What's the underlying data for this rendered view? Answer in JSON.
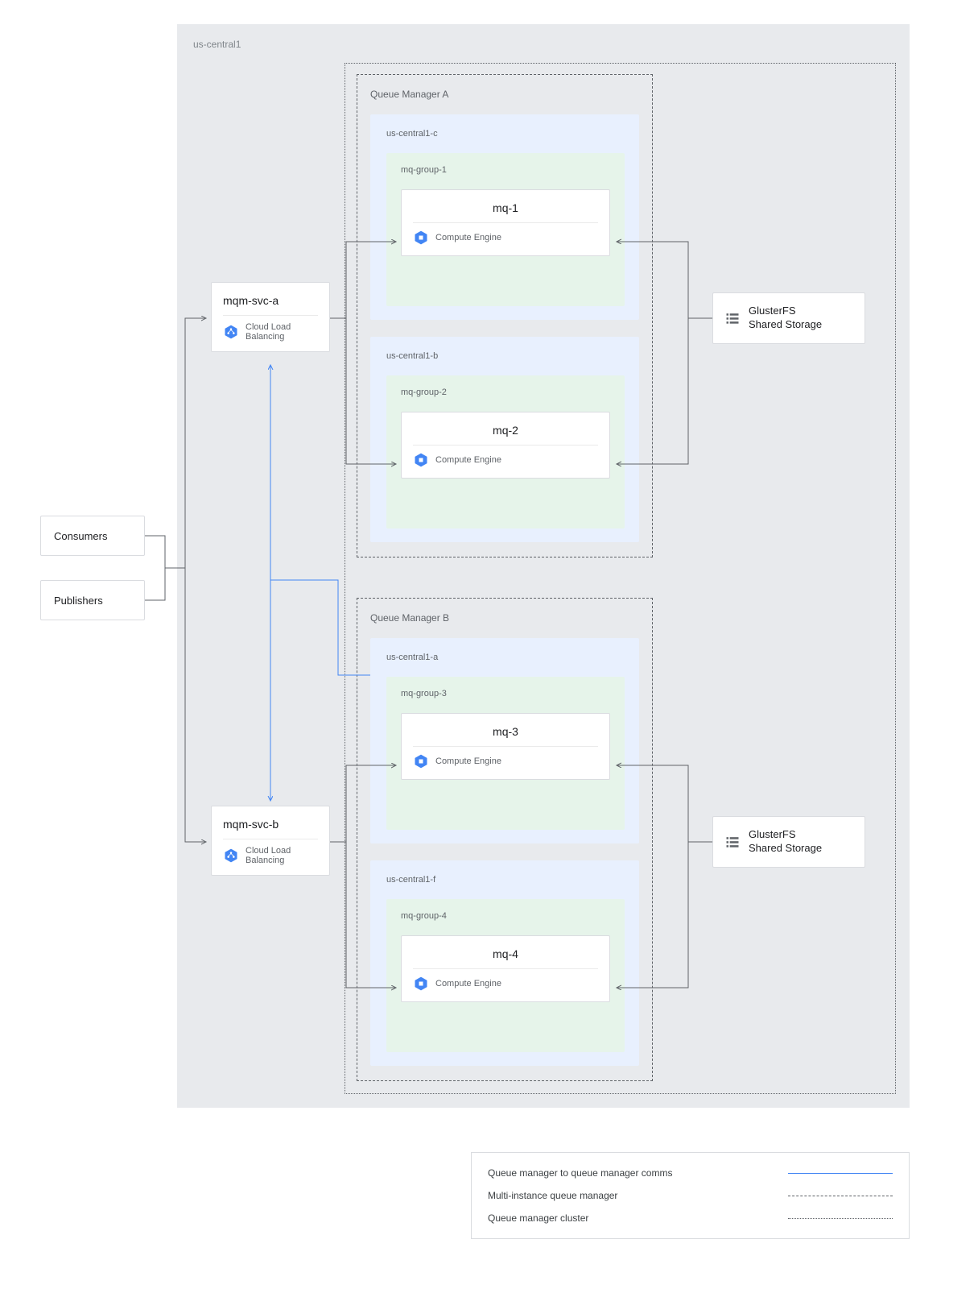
{
  "region": {
    "label": "us-central1"
  },
  "clients": {
    "consumers": "Consumers",
    "publishers": "Publishers"
  },
  "services": {
    "a": {
      "title": "mqm-svc-a",
      "sub": "Cloud Load Balancing"
    },
    "b": {
      "title": "mqm-svc-b",
      "sub": "Cloud Load Balancing"
    }
  },
  "queue_managers": {
    "a": {
      "label": "Queue Manager A",
      "zones": [
        {
          "zone": "us-central1-c",
          "group": "mq-group-1",
          "node": {
            "title": "mq-1",
            "sub": "Compute Engine"
          }
        },
        {
          "zone": "us-central1-b",
          "group": "mq-group-2",
          "node": {
            "title": "mq-2",
            "sub": "Compute Engine"
          }
        }
      ]
    },
    "b": {
      "label": "Queue Manager B",
      "zones": [
        {
          "zone": "us-central1-a",
          "group": "mq-group-3",
          "node": {
            "title": "mq-3",
            "sub": "Compute Engine"
          }
        },
        {
          "zone": "us-central1-f",
          "group": "mq-group-4",
          "node": {
            "title": "mq-4",
            "sub": "Compute Engine"
          }
        }
      ]
    }
  },
  "storage": {
    "line1": "GlusterFS",
    "line2": "Shared Storage"
  },
  "legend": {
    "row1": "Queue manager to queue manager comms",
    "row2": "Multi-instance queue manager",
    "row3": "Queue manager cluster"
  },
  "icons": {
    "lb": "cloud-load-balancing-icon",
    "compute": "compute-engine-icon",
    "list": "list-icon"
  }
}
